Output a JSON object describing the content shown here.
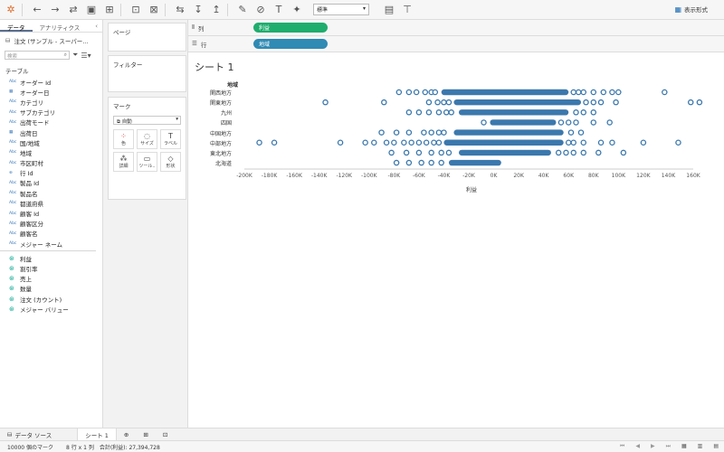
{
  "toolbar": {
    "format_select": "標準",
    "show_me_label": "表示形式"
  },
  "data_pane": {
    "tabs": [
      "データ",
      "アナリティクス"
    ],
    "datasource": "注文 (サンプル - スーパー…",
    "search_placeholder": "検索",
    "section_label": "テーブル",
    "dimensions": [
      {
        "icon": "Abc",
        "label": "オーダー Id"
      },
      {
        "icon": "cal",
        "label": "オーダー日"
      },
      {
        "icon": "Abc",
        "label": "カテゴリ"
      },
      {
        "icon": "Abc",
        "label": "サブカテゴリ"
      },
      {
        "icon": "Abc",
        "label": "出荷モード"
      },
      {
        "icon": "cal",
        "label": "出荷日"
      },
      {
        "icon": "Abc",
        "label": "国/地域"
      },
      {
        "icon": "Abc",
        "label": "地域"
      },
      {
        "icon": "Abc",
        "label": "市区町村"
      },
      {
        "icon": "#",
        "label": "行 Id"
      },
      {
        "icon": "Abc",
        "label": "製品 Id"
      },
      {
        "icon": "Abc",
        "label": "製品名"
      },
      {
        "icon": "Abc",
        "label": "都道府県"
      },
      {
        "icon": "Abc",
        "label": "顧客 Id"
      },
      {
        "icon": "Abc",
        "label": "顧客区分"
      },
      {
        "icon": "Abc",
        "label": "顧客名"
      },
      {
        "icon": "Abc",
        "label": "メジャー ネーム"
      }
    ],
    "measures": [
      {
        "icon": "#",
        "label": "利益"
      },
      {
        "icon": "#",
        "label": "割引率"
      },
      {
        "icon": "#",
        "label": "売上"
      },
      {
        "icon": "#",
        "label": "数量"
      },
      {
        "icon": "#",
        "label": "注文 (カウント)"
      },
      {
        "icon": "#",
        "label": "メジャー バリュー"
      }
    ]
  },
  "cards": {
    "pages": "ページ",
    "filters": "フィルター",
    "marks": "マーク",
    "mark_type": "自動",
    "mark_buttons": [
      {
        "icon": "color-icon",
        "label": "色"
      },
      {
        "icon": "size-icon",
        "label": "サイズ"
      },
      {
        "icon": "label-icon",
        "label": "ラベル"
      },
      {
        "icon": "detail-icon",
        "label": "詳細"
      },
      {
        "icon": "tooltip-icon",
        "label": "ツール.."
      },
      {
        "icon": "shape-icon",
        "label": "形状"
      }
    ]
  },
  "shelves": {
    "columns_label": "列",
    "columns_pill": "利益",
    "rows_label": "行",
    "rows_pill": "地域"
  },
  "sheet": {
    "title": "シート 1",
    "row_header": "地域"
  },
  "chart_data": {
    "type": "scatter",
    "xlabel": "利益",
    "ylabel": "地域",
    "categories": [
      "関西地方",
      "関東地方",
      "九州",
      "四国",
      "中国地方",
      "中部地方",
      "東北地方",
      "北海道"
    ],
    "x_ticks": [
      "-200K",
      "-180K",
      "-160K",
      "-140K",
      "-120K",
      "-100K",
      "-80K",
      "-60K",
      "-40K",
      "-20K",
      "0K",
      "20K",
      "40K",
      "60K",
      "80K",
      "100K",
      "120K",
      "140K",
      "160K"
    ],
    "xlim": [
      -200000,
      160000
    ],
    "series": [
      {
        "category": "関西地方",
        "dense_range": [
          -42000,
          60000
        ],
        "outliers": [
          -76000,
          -68000,
          -62000,
          -55000,
          -50000,
          -47000,
          64000,
          68000,
          72000,
          80000,
          88000,
          95000,
          100000,
          137000
        ]
      },
      {
        "category": "関東地方",
        "dense_range": [
          -32000,
          70000
        ],
        "outliers": [
          -135000,
          -88000,
          -52000,
          -45000,
          -40000,
          -36000,
          74000,
          80000,
          86000,
          98000,
          158000,
          165000
        ]
      },
      {
        "category": "九州",
        "dense_range": [
          -28000,
          60000
        ],
        "outliers": [
          -68000,
          -60000,
          -52000,
          -44000,
          -38000,
          -34000,
          66000,
          72000,
          80000
        ]
      },
      {
        "category": "四国",
        "dense_range": [
          -3000,
          50000
        ],
        "outliers": [
          -8000,
          54000,
          60000,
          66000,
          80000,
          93000
        ]
      },
      {
        "category": "中国地方",
        "dense_range": [
          -32000,
          56000
        ],
        "outliers": [
          -90000,
          -78000,
          -68000,
          -56000,
          -50000,
          -44000,
          -40000,
          62000,
          70000
        ]
      },
      {
        "category": "中部地方",
        "dense_range": [
          -40000,
          56000
        ],
        "outliers": [
          -188000,
          -176000,
          -123000,
          -103000,
          -96000,
          -86000,
          -80000,
          -72000,
          -66000,
          -60000,
          -54000,
          -48000,
          -44000,
          60000,
          64000,
          72000,
          86000,
          95000,
          120000,
          148000
        ]
      },
      {
        "category": "東北地方",
        "dense_range": [
          -28000,
          46000
        ],
        "outliers": [
          -82000,
          -70000,
          -60000,
          -50000,
          -42000,
          -36000,
          52000,
          58000,
          64000,
          72000,
          84000,
          104000
        ]
      },
      {
        "category": "北海道",
        "dense_range": [
          -36000,
          6000
        ],
        "outliers": [
          -78000,
          -68000,
          -58000,
          -50000,
          -42000
        ]
      }
    ]
  },
  "bottom": {
    "datasource_tab": "データ ソース",
    "sheet_tab": "シート 1",
    "status_marks": "10000 個のマーク",
    "status_rows": "8 行 x 1 列",
    "status_sum": "合計(利益): 27,394,728"
  }
}
